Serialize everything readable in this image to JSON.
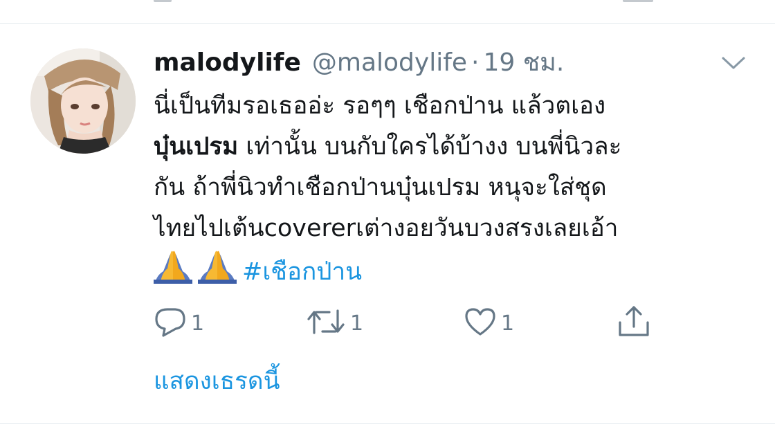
{
  "tweet": {
    "display_name": "malodylife",
    "handle": "@malodylife",
    "separator": "·",
    "time": "19 ชม.",
    "text_lines": {
      "l1": "นี่เป็นทีมรอเธออ่ะ รอๆๆ เชือกป่าน แล้วตเอง",
      "l2_bold": "บุ๋นเปรม",
      "l2_rest": " เท่านั้น บนกับใครได้บ้างง บนพี่นิวละ",
      "l3": "กัน ถ้าพี่นิวทำเชือกป่านบุ๋นเปรม หนุจะใส่ชุด",
      "l4": "ไทยไปเต้นcovererเต่างอยวันบวงสรงเลยเอ้า"
    },
    "emojis": [
      "folded-hands",
      "folded-hands"
    ],
    "hashtag": "#เชือกป่าน"
  },
  "actions": {
    "reply_count": "1",
    "retweet_count": "1",
    "like_count": "1"
  },
  "show_thread_label": "แสดงเธรดนี้",
  "colors": {
    "text": "#14171a",
    "secondary": "#657786",
    "link": "#1b95e0",
    "divider": "#e1e8ed"
  }
}
